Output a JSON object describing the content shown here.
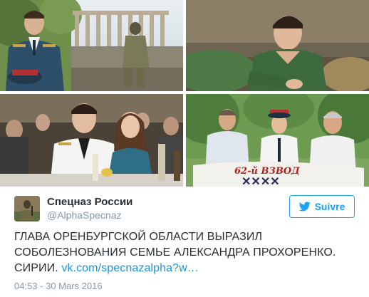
{
  "tweet": {
    "author": {
      "name": "Спецназ России",
      "handle": "@AlphaSpecnaz"
    },
    "follow_label": "Suivre",
    "text_lines": [
      "ГЛАВА ОРЕНБУРГСКОЙ ОБЛАСТИ ВЫРАЗИЛ",
      "СОБОЛЕЗНОВАНИЯ СЕМЬЕ АЛЕКСАНДРА ПРОХОРЕНКО.",
      "СИРИИ."
    ],
    "link_text": "vk.com/specnazalpha?w…",
    "timestamp": "04:53 - 30 Mars 2016"
  },
  "photos": {
    "banner_text": "62-й ВЗВОД"
  },
  "colors": {
    "accent": "#1da1f2",
    "link": "#1b95e0",
    "muted": "#8899a6",
    "text": "#292f33"
  },
  "icons": {
    "follow": "twitter-bird-icon"
  }
}
